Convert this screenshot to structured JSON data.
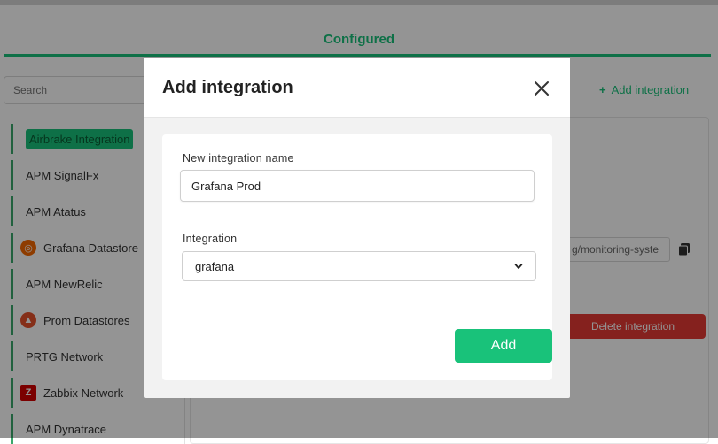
{
  "background": {
    "tab_title": "Configured",
    "search_placeholder": "Search",
    "add_integration_link": "Add integration",
    "sidebar": [
      {
        "label": "Airbrake Integration",
        "icon": null,
        "active": true
      },
      {
        "label": "APM SignalFx",
        "icon": null
      },
      {
        "label": "APM Atatus",
        "icon": null
      },
      {
        "label": "Grafana Datastore",
        "icon": "grafana-icon"
      },
      {
        "label": "APM NewRelic",
        "icon": null
      },
      {
        "label": "Prom Datastores",
        "icon": "prometheus-icon"
      },
      {
        "label": "PRTG Network",
        "icon": null
      },
      {
        "label": "Zabbix Network",
        "icon": "zabbix-icon"
      },
      {
        "label": "APM Dynatrace",
        "icon": null
      }
    ],
    "url_value": "g/monitoring-syste",
    "delete_button": "Delete integration"
  },
  "modal": {
    "title": "Add integration",
    "name_label": "New integration name",
    "name_value": "Grafana Prod",
    "integration_label": "Integration",
    "integration_selected": "grafana",
    "add_button": "Add"
  },
  "colors": {
    "accent": "#19c27a",
    "danger": "#e53935",
    "grafana": "#f46800",
    "prometheus": "#e6522c",
    "zabbix": "#d40000"
  }
}
